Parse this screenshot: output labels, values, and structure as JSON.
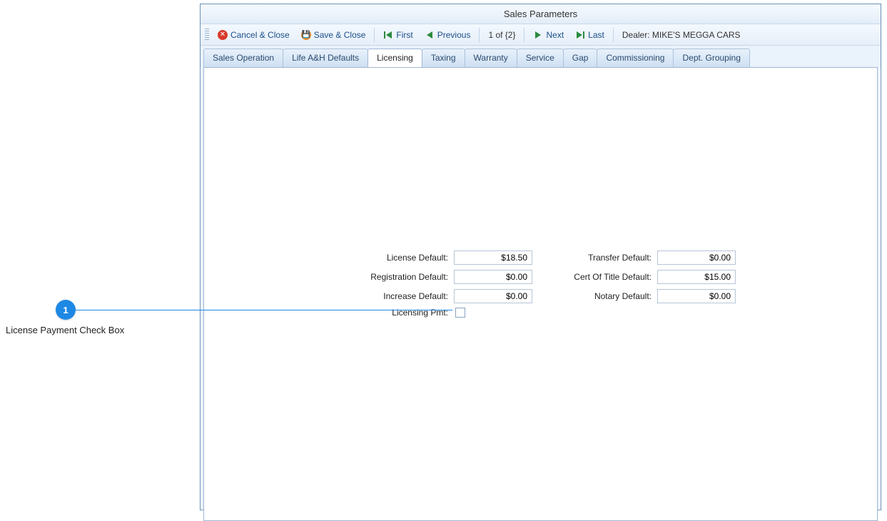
{
  "window": {
    "title": "Sales Parameters"
  },
  "toolbar": {
    "cancel_label": "Cancel & Close",
    "save_label": "Save & Close",
    "first_label": "First",
    "previous_label": "Previous",
    "position_label": "1 of {2}",
    "next_label": "Next",
    "last_label": "Last",
    "dealer_label": "Dealer: MIKE'S MEGGA CARS"
  },
  "tabs": [
    {
      "label": "Sales Operation"
    },
    {
      "label": "Life A&H Defaults"
    },
    {
      "label": "Licensing",
      "active": true
    },
    {
      "label": "Taxing"
    },
    {
      "label": "Warranty"
    },
    {
      "label": "Service"
    },
    {
      "label": "Gap"
    },
    {
      "label": "Commissioning"
    },
    {
      "label": "Dept. Grouping"
    }
  ],
  "form": {
    "left": [
      {
        "label": "License Default:",
        "value": "$18.50"
      },
      {
        "label": "Registration Default:",
        "value": "$0.00"
      },
      {
        "label": "Increase Default:",
        "value": "$0.00"
      }
    ],
    "right": [
      {
        "label": "Transfer Default:",
        "value": "$0.00"
      },
      {
        "label": "Cert Of Title Default:",
        "value": "$15.00"
      },
      {
        "label": "Notary Default:",
        "value": "$0.00"
      }
    ],
    "checkbox": {
      "label": "Licensing Pmt:",
      "checked": false
    }
  },
  "callout": {
    "number": "1",
    "text": "License Payment Check Box"
  }
}
